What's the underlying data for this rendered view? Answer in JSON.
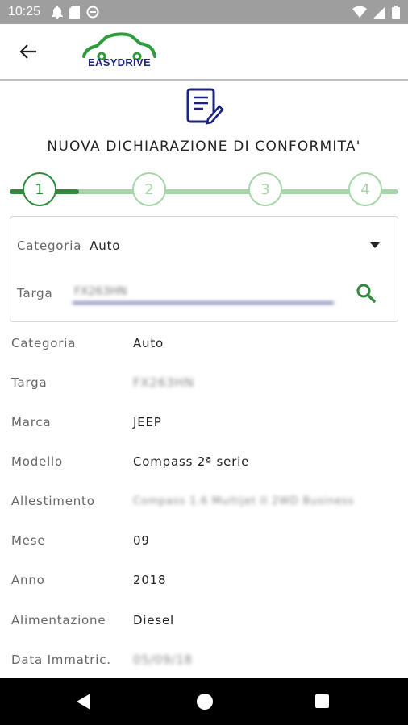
{
  "status_bar": {
    "time": "10:25",
    "left_icons": [
      "notification-bell-icon",
      "sd-card-icon",
      "do-not-disturb-icon"
    ],
    "right_icons": [
      "wifi-icon",
      "signal-icon",
      "battery-icon"
    ],
    "background": "#9e9e9e"
  },
  "appbar": {
    "back_icon": "arrow-left-icon",
    "logo_text": "EASYDRIVE",
    "logo_colors": {
      "car": "#2e9c3a",
      "text": "#1a237e"
    }
  },
  "page": {
    "title": "NUOVA DICHIARAZIONE DI CONFORMITA'",
    "doc_icon": "document-edit-icon"
  },
  "stepper": {
    "steps": [
      {
        "label": "1",
        "active": true
      },
      {
        "label": "2",
        "active": false
      },
      {
        "label": "3",
        "active": false
      },
      {
        "label": "4",
        "active": false
      }
    ],
    "active_color": "#2e8b3c",
    "inactive_color": "#9fd1a0"
  },
  "search": {
    "categoria_label": "Categoria",
    "categoria_value": "Auto",
    "targa_label": "Targa",
    "targa_value": "FX263HN",
    "search_icon": "magnifier-icon",
    "accent": "#2e8b3c",
    "underline": "#1a237e"
  },
  "details": [
    {
      "label": "Categoria",
      "value": "Auto",
      "blurred": false
    },
    {
      "label": "Targa",
      "value": "FX263HN",
      "blurred": true
    },
    {
      "label": "Marca",
      "value": "JEEP",
      "blurred": false
    },
    {
      "label": "Modello",
      "value": "Compass 2ª serie",
      "blurred": false
    },
    {
      "label": "Allestimento",
      "value": "Compass 1.6 Multijet II 2WD Business",
      "blurred": true
    },
    {
      "label": "Mese",
      "value": "09",
      "blurred": false
    },
    {
      "label": "Anno",
      "value": "2018",
      "blurred": false
    },
    {
      "label": "Alimentazione",
      "value": "Diesel",
      "blurred": false
    },
    {
      "label": "Data Immatric.",
      "value": "05/09/18",
      "blurred": true
    }
  ],
  "nav_bar": {
    "icons": [
      "nav-back-icon",
      "nav-home-icon",
      "nav-recents-icon"
    ]
  }
}
